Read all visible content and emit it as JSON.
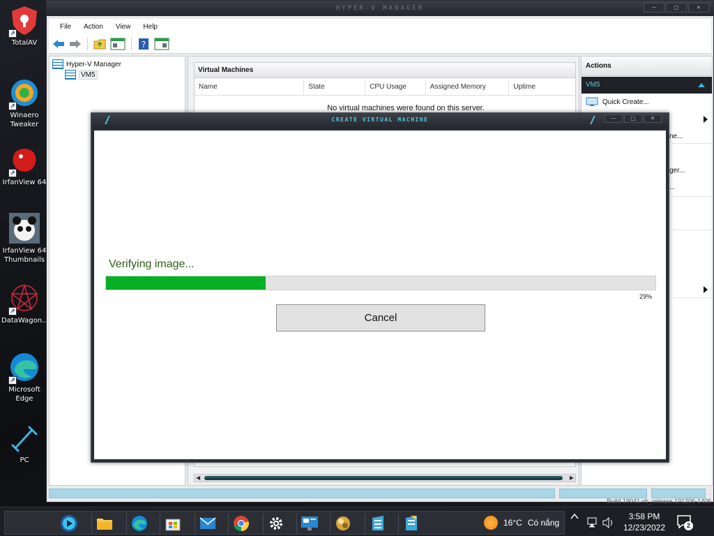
{
  "desktop": {
    "icons": [
      {
        "label": "TotalAV",
        "icon": "totalav-shield-icon"
      },
      {
        "label": "Winaero Tweaker",
        "icon": "winaero-tweaker-icon"
      },
      {
        "label": "IrfanView 64",
        "icon": "irfanview-icon"
      },
      {
        "label": "IrfanView 64 Thumbnails",
        "icon": "irfanview-thumbnails-icon"
      },
      {
        "label": "DataWagon...",
        "icon": "datawagon-icon"
      },
      {
        "label": "Microsoft Edge",
        "icon": "edge-icon"
      },
      {
        "label": "PC",
        "icon": "pc-icon"
      }
    ]
  },
  "window": {
    "title": "HYPER-V MANAGER",
    "controls": [
      "—",
      "□",
      "✕"
    ]
  },
  "menubar": [
    "File",
    "Action",
    "View",
    "Help"
  ],
  "toolbar": {
    "icons": [
      "back-arrow-icon",
      "forward-arrow-icon",
      "folder-up-icon",
      "show-hide-console-tree-icon",
      "help-icon",
      "show-action-pane-icon"
    ]
  },
  "tree": {
    "root": "Hyper-V Manager",
    "child": "VM5"
  },
  "vm_panel": {
    "title": "Virtual Machines",
    "columns": [
      "Name",
      "State",
      "CPU Usage",
      "Assigned Memory",
      "Uptime"
    ],
    "empty_message": "No virtual machines were found on this server."
  },
  "actions": {
    "header": "Actions",
    "section": "VM5",
    "items": [
      {
        "label": "Quick Create...",
        "icon": "quick-create-icon"
      }
    ],
    "partial": [
      "ne...",
      "ger...",
      "..."
    ]
  },
  "status": {
    "build": "Build 19041.vb_release.191206-1406"
  },
  "dialog": {
    "title": "CREATE VIRTUAL MACHINE",
    "controls": [
      "—",
      "□",
      "✕"
    ],
    "message": "Verifying image...",
    "progress": 0.29,
    "progress_label": "29%",
    "cancel_label": "Cancel",
    "accent": "#58c6e0",
    "progress_color": "#06b025"
  },
  "taskbar": {
    "apps": [
      "media-player-icon",
      "file-explorer-icon",
      "edge-icon",
      "microsoft-store-icon",
      "mail-icon",
      "chrome-icon",
      "settings-gear-icon",
      "remote-desktop-icon",
      "sphere-app-icon",
      "hyper-v-server-icon",
      "hyper-v-quick-create-icon"
    ],
    "weather_temp": "16°C",
    "weather_text": "Có nắng",
    "time": "3:58 PM",
    "date": "12/23/2022",
    "notification_count": "2"
  }
}
